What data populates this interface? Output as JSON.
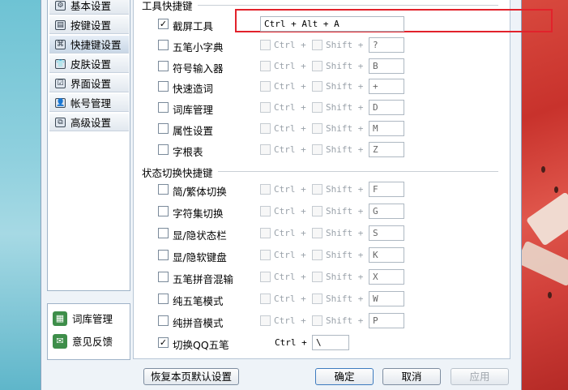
{
  "sidebar": {
    "items": [
      {
        "label": "基本设置",
        "icon": "settings-icon",
        "glyph": "⚙"
      },
      {
        "label": "按键设置",
        "icon": "keyboard-icon",
        "glyph": "▤"
      },
      {
        "label": "快捷键设置",
        "icon": "shortcut-icon",
        "glyph": "⌘"
      },
      {
        "label": "皮肤设置",
        "icon": "shirt-icon",
        "glyph": "👕"
      },
      {
        "label": "界面设置",
        "icon": "interface-icon",
        "glyph": "☑"
      },
      {
        "label": "帐号管理",
        "icon": "user-icon",
        "glyph": "👤"
      },
      {
        "label": "高级设置",
        "icon": "advanced-icon",
        "glyph": "⧉"
      }
    ],
    "active_index": 2,
    "bottom": [
      {
        "label": "词库管理",
        "icon": "dictionary-icon",
        "glyph": "▦"
      },
      {
        "label": "意见反馈",
        "icon": "feedback-icon",
        "glyph": "✉"
      }
    ]
  },
  "groups": {
    "tools": {
      "title": "工具快捷键"
    },
    "state": {
      "title": "状态切换快捷键"
    }
  },
  "modifiers": {
    "ctrl": "Ctrl +",
    "shift": "Shift +"
  },
  "tools_rows": [
    {
      "label": "截屏工具",
      "checked": true,
      "combo": "Ctrl + Alt + A"
    },
    {
      "label": "五笔小字典",
      "checked": false,
      "key": "?"
    },
    {
      "label": "符号输入器",
      "checked": false,
      "key": "B"
    },
    {
      "label": "快速造词",
      "checked": false,
      "key": "+"
    },
    {
      "label": "词库管理",
      "checked": false,
      "key": "D"
    },
    {
      "label": "属性设置",
      "checked": false,
      "key": "M"
    },
    {
      "label": "字根表",
      "checked": false,
      "key": "Z"
    }
  ],
  "state_rows": [
    {
      "label": "简/繁体切换",
      "checked": false,
      "key": "F"
    },
    {
      "label": "字符集切换",
      "checked": false,
      "key": "G"
    },
    {
      "label": "显/隐状态栏",
      "checked": false,
      "key": "S"
    },
    {
      "label": "显/隐软键盘",
      "checked": false,
      "key": "K"
    },
    {
      "label": "五笔拼音混输",
      "checked": false,
      "key": "X"
    },
    {
      "label": "纯五笔模式",
      "checked": false,
      "key": "W"
    },
    {
      "label": "纯拼音模式",
      "checked": false,
      "key": "P"
    },
    {
      "label": "切换QQ五笔",
      "checked": true,
      "ctrl_only": true,
      "key": "\\"
    }
  ],
  "buttons": {
    "restore": "恢复本页默认设置",
    "ok": "确定",
    "cancel": "取消",
    "apply": "应用"
  },
  "colors": {
    "highlight": "#e2222b",
    "accent": "#3d7bbf"
  }
}
